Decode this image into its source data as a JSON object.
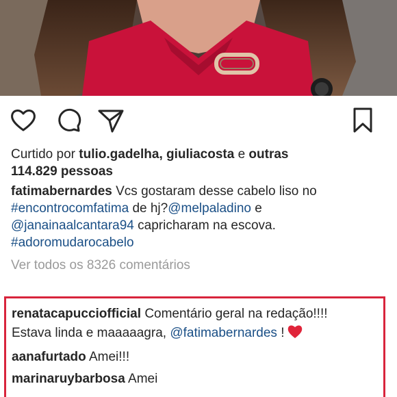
{
  "post": {
    "likes": {
      "prefix": "Curtido por",
      "user1": "tulio.gadelha",
      "separator": ",",
      "user2": "giuliacosta",
      "conjunction": "e",
      "others": "outras",
      "count_text": "114.829 pessoas"
    },
    "caption": {
      "author": "fatimabernardes",
      "text1": "Vcs gostaram desse cabelo liso no",
      "hashtag1": "#encontrocomfatima",
      "text2": "de hj?",
      "mention1": "@melpaladino",
      "text3": "e",
      "mention2": "@janainaalcantara94",
      "text4": "capricharam na escova.",
      "hashtag2": "#adoromudarocabelo"
    },
    "view_all_comments": "Ver todos os 8326 comentários"
  },
  "comments": [
    {
      "user": "renatacapucciofficial",
      "text1": "Comentário geral na redação!!!!",
      "text2": "Estava linda e maaaaagra,",
      "mention": "@fatimabernardes",
      "text3": "!"
    },
    {
      "user": "aanafurtado",
      "text": "Amei!!!"
    },
    {
      "user": "marinaruybarbosa",
      "text": "Amei"
    }
  ],
  "icons": {
    "like": "heart-outline-icon",
    "comment": "speech-bubble-icon",
    "share": "paper-plane-icon",
    "save": "bookmark-icon",
    "comment_heart": "red-heart-icon"
  },
  "colors": {
    "highlight_border": "#d8243c",
    "link": "#1a4f86",
    "muted": "#9a9a9a",
    "heart": "#e0243a"
  }
}
